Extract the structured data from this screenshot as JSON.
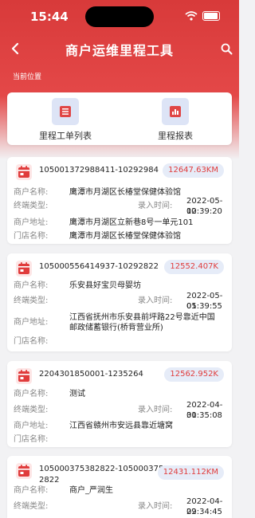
{
  "status_bar": {
    "time": "15:44"
  },
  "nav": {
    "title": "商户运维里程工具"
  },
  "location_label": "当前位置",
  "menu": [
    {
      "label": "里程工单列表",
      "icon": "list-icon"
    },
    {
      "label": "里程报表",
      "icon": "bar-chart-icon"
    }
  ],
  "field_labels": {
    "merchant_name": "商户名称:",
    "terminal_type": "终端类型:",
    "entry_time": "录入时间:",
    "merchant_address": "商户地址:",
    "store_name": "门店名称:"
  },
  "colors": {
    "brand_red": "#d83a3a",
    "badge_bg": "#e6ecf8"
  },
  "cards": [
    {
      "id": "105001372988411-10292984",
      "km": "12647.63KM",
      "merchant_name": "鹰潭市月湖区长椿堂保健体验馆",
      "terminal_type": "",
      "entry_date": "2022-05-10",
      "entry_time": "02:39:20",
      "merchant_address": "鹰潭市月湖区立新巷8号一单元101",
      "store_name": "鹰潭市月湖区长椿堂保健体验馆"
    },
    {
      "id": "105000556414937-10292822",
      "km": "12552.407K",
      "merchant_name": "乐安县好宝贝母婴坊",
      "terminal_type": "",
      "entry_date": "2022-05-05",
      "entry_time": "01:39:55",
      "merchant_address": "江西省抚州市乐安县前坪路22号靠近中国邮政储蓄银行(桥背营业所)",
      "store_name": ""
    },
    {
      "id": "2204301850001-1235264",
      "km": "12562.952K",
      "merchant_name": "测试",
      "terminal_type": "",
      "entry_date": "2022-04-30",
      "entry_time": "01:35:08",
      "merchant_address": "江西省赣州市安远县靠近塘窝",
      "store_name": ""
    },
    {
      "id": "105000375382822-105000375382822",
      "km": "12431.112KM",
      "merchant_name": "商户_严润生",
      "terminal_type": "",
      "entry_date": "2022-04-29",
      "entry_time": "02:34:45",
      "merchant_address": "",
      "store_name": ""
    }
  ]
}
